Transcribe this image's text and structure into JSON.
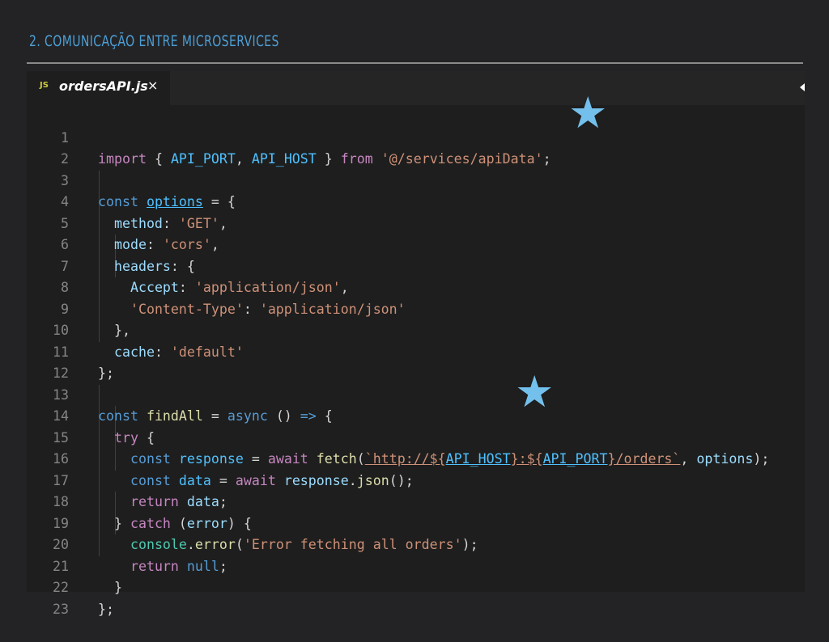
{
  "slide": {
    "title": "2. COMUNICAÇÃO ENTRE MICROSERVICES"
  },
  "editor": {
    "tab": {
      "icon_label": "JS",
      "file_name": "ordersAPI.js",
      "close_glyph": "×"
    },
    "lines": [
      {
        "n": "1"
      },
      {
        "n": "2"
      },
      {
        "n": "3"
      },
      {
        "n": "4"
      },
      {
        "n": "5"
      },
      {
        "n": "6"
      },
      {
        "n": "7"
      },
      {
        "n": "8"
      },
      {
        "n": "9"
      },
      {
        "n": "10"
      },
      {
        "n": "11"
      },
      {
        "n": "12"
      },
      {
        "n": "13"
      },
      {
        "n": "14"
      },
      {
        "n": "15"
      },
      {
        "n": "16"
      },
      {
        "n": "17"
      },
      {
        "n": "18"
      },
      {
        "n": "19"
      },
      {
        "n": "20"
      },
      {
        "n": "21"
      },
      {
        "n": "22"
      },
      {
        "n": "23"
      }
    ],
    "code": {
      "l1": {
        "import": "import",
        "open": "{ ",
        "a": "API_PORT",
        ",": ", ",
        "b": "API_HOST",
        "close": " } ",
        "from": "from",
        "s": "'@/services/apiData'",
        "end": ";"
      },
      "l3": {
        "const": "const",
        "name": "options",
        "rest": " = {"
      },
      "l4": {
        "key": "method",
        "colon": ": ",
        "val": "'GET'",
        "end": ","
      },
      "l5": {
        "key": "mode",
        "colon": ": ",
        "val": "'cors'",
        "end": ","
      },
      "l6": {
        "key": "headers",
        "rest": ": {"
      },
      "l7": {
        "key": "Accept",
        "colon": ": ",
        "val": "'application/json'",
        "end": ","
      },
      "l8": {
        "key": "'Content-Type'",
        "colon": ": ",
        "val": "'application/json'"
      },
      "l9": {
        "text": "},"
      },
      "l10": {
        "key": "cache",
        "colon": ": ",
        "val": "'default'"
      },
      "l11": {
        "text": "};"
      },
      "l13": {
        "const": "const",
        "name": "findAll",
        "eq": " = ",
        "async": "async",
        "rest": " () ",
        "arrow": "=>",
        "brace": " {"
      },
      "l14": {
        "try": "try",
        "rest": " {"
      },
      "l15": {
        "const": "const",
        "name": "response",
        "eq": " = ",
        "await": "await",
        "fetch": "fetch",
        "paren": "(",
        "tpl1": "`http://${",
        "host": "API_HOST",
        "tpl2": "}:${",
        "port": "API_PORT",
        "tpl3": "}/orders`",
        "comma": ", ",
        "opts": "options",
        "end": ");"
      },
      "l16": {
        "const": "const",
        "name": "data",
        "eq": " = ",
        "await": "await",
        "resp": "response",
        "dot": ".",
        "json": "json",
        "end": "();"
      },
      "l17": {
        "ret": "return",
        "name": "data",
        "end": ";"
      },
      "l18": {
        "close": "} ",
        "catch": "catch",
        "open": " (",
        "err": "error",
        "rest": ") {"
      },
      "l19": {
        "console": "console",
        "dot": ".",
        "error": "error",
        "paren": "(",
        "s": "'Error fetching all orders'",
        "end": ");"
      },
      "l20": {
        "ret": "return",
        "nul": "null",
        "end": ";"
      },
      "l21": {
        "text": "}"
      },
      "l22": {
        "text": "};"
      }
    }
  },
  "colors": {
    "title": "#4d9fd6",
    "star": "#74c0ec",
    "editor_bg": "#1e1e1e",
    "slide_bg": "#232325"
  }
}
